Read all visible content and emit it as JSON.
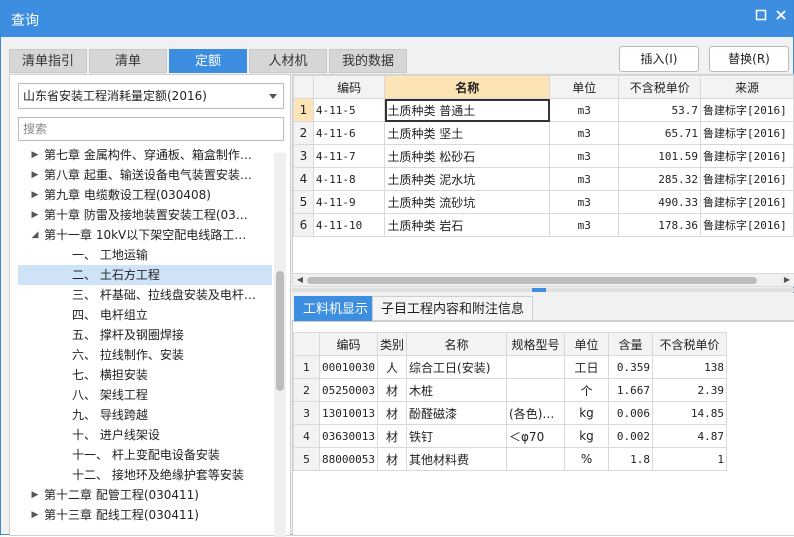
{
  "window": {
    "title": "查询"
  },
  "tabs": [
    "清单指引",
    "清单",
    "定额",
    "人材机",
    "我的数据"
  ],
  "buttons": {
    "insert": "插入(I)",
    "replace": "替换(R)"
  },
  "left": {
    "selected_db": "山东省安装工程消耗量定额(2016)",
    "search_placeholder": "搜索",
    "tree": [
      {
        "label": "第七章 金属构件、穿通板、箱盒制作…",
        "level": 1,
        "arrow": "right"
      },
      {
        "label": "第八章 起重、输送设备电气装置安装…",
        "level": 1,
        "arrow": "right"
      },
      {
        "label": "第九章 电缆敷设工程(030408)",
        "level": 1,
        "arrow": "right"
      },
      {
        "label": "第十章 防雷及接地装置安装工程(03…",
        "level": 1,
        "arrow": "right"
      },
      {
        "label": "第十一章 10kV以下架空配电线路工…",
        "level": 1,
        "arrow": "down"
      },
      {
        "label": "一、 工地运输",
        "level": 2,
        "arrow": ""
      },
      {
        "label": "二、 土石方工程",
        "level": 2,
        "arrow": "",
        "selected": true
      },
      {
        "label": "三、 杆基础、拉线盘安装及电杆…",
        "level": 2,
        "arrow": ""
      },
      {
        "label": "四、 电杆组立",
        "level": 2,
        "arrow": ""
      },
      {
        "label": "五、 撑杆及钢圈焊接",
        "level": 2,
        "arrow": ""
      },
      {
        "label": "六、 拉线制作、安装",
        "level": 2,
        "arrow": ""
      },
      {
        "label": "七、 横担安装",
        "level": 2,
        "arrow": ""
      },
      {
        "label": "八、 架线工程",
        "level": 2,
        "arrow": ""
      },
      {
        "label": "九、 导线跨越",
        "level": 2,
        "arrow": ""
      },
      {
        "label": "十、 进户线架设",
        "level": 2,
        "arrow": ""
      },
      {
        "label": "十一、 杆上变配电设备安装",
        "level": 2,
        "arrow": ""
      },
      {
        "label": "十二、 接地环及绝缘护套等安装",
        "level": 2,
        "arrow": ""
      },
      {
        "label": "第十二章 配管工程(030411)",
        "level": 1,
        "arrow": "right"
      },
      {
        "label": "第十三章 配线工程(030411)",
        "level": 1,
        "arrow": "right"
      }
    ]
  },
  "grid": {
    "columns": [
      "编码",
      "名称",
      "单位",
      "不含税单价",
      "来源"
    ],
    "rows": [
      {
        "n": "1",
        "code": "4-11-5",
        "name": "土质种类 普通土",
        "unit": "m3",
        "price": "53.7",
        "source": "鲁建标字[2016]"
      },
      {
        "n": "2",
        "code": "4-11-6",
        "name": "土质种类 坚土",
        "unit": "m3",
        "price": "65.71",
        "source": "鲁建标字[2016]"
      },
      {
        "n": "3",
        "code": "4-11-7",
        "name": "土质种类 松砂石",
        "unit": "m3",
        "price": "101.59",
        "source": "鲁建标字[2016]"
      },
      {
        "n": "4",
        "code": "4-11-8",
        "name": "土质种类 泥水坑",
        "unit": "m3",
        "price": "285.32",
        "source": "鲁建标字[2016]"
      },
      {
        "n": "5",
        "code": "4-11-9",
        "name": "土质种类 流砂坑",
        "unit": "m3",
        "price": "490.33",
        "source": "鲁建标字[2016]"
      },
      {
        "n": "6",
        "code": "4-11-10",
        "name": "土质种类 岩石",
        "unit": "m3",
        "price": "178.36",
        "source": "鲁建标字[2016]"
      }
    ]
  },
  "bottom": {
    "tabs": [
      "工料机显示",
      "子目工程内容和附注信息"
    ],
    "columns": [
      "编码",
      "类别",
      "名称",
      "规格型号",
      "单位",
      "含量",
      "不含税单价"
    ],
    "rows": [
      {
        "n": "1",
        "code": "00010030",
        "cat": "人",
        "name": "综合工日(安装)",
        "spec": "",
        "unit": "工日",
        "qty": "0.359",
        "price": "138"
      },
      {
        "n": "2",
        "code": "05250003",
        "cat": "材",
        "name": "木桩",
        "spec": "",
        "unit": "个",
        "qty": "1.667",
        "price": "2.39"
      },
      {
        "n": "3",
        "code": "13010013",
        "cat": "材",
        "name": "酚醛磁漆",
        "spec": "(各色)…",
        "unit": "kg",
        "qty": "0.006",
        "price": "14.85"
      },
      {
        "n": "4",
        "code": "03630013",
        "cat": "材",
        "name": "铁钉",
        "spec": "＜φ70",
        "unit": "kg",
        "qty": "0.002",
        "price": "4.87"
      },
      {
        "n": "5",
        "code": "88000053",
        "cat": "材",
        "name": "其他材料费",
        "spec": "",
        "unit": "%",
        "qty": "1.8",
        "price": "1"
      }
    ]
  }
}
